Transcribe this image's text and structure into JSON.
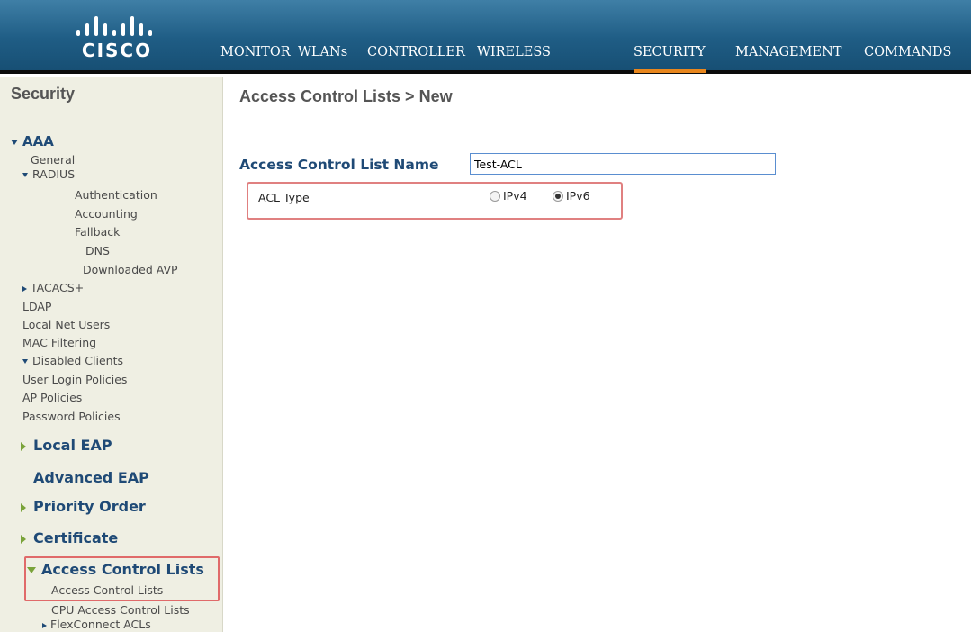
{
  "header": {
    "brand": "CISCO",
    "nav": [
      {
        "label": "MONITOR"
      },
      {
        "label": "WLANs"
      },
      {
        "label": "CONTROLLER"
      },
      {
        "label": "WIRELESS"
      },
      {
        "label": "SECURITY",
        "active": true
      },
      {
        "label": "MANAGEMENT"
      },
      {
        "label": "COMMANDS"
      }
    ],
    "active_underline_color": "#e8861d"
  },
  "sidebar": {
    "title": "Security",
    "aaa": {
      "label": "AAA",
      "general": "General",
      "radius": "RADIUS",
      "authentication": "Authentication",
      "accounting": "Accounting",
      "fallback": "Fallback",
      "dns": "DNS",
      "downloaded_avp": "Downloaded AVP",
      "tacacs": "TACACS+",
      "ldap": "LDAP",
      "local_net_users": "Local Net Users",
      "mac_filtering": "MAC Filtering",
      "disabled_clients": "Disabled Clients",
      "user_login_policies": "User Login Policies",
      "ap_policies": "AP Policies",
      "password_policies": "Password Policies"
    },
    "local_eap": "Local EAP",
    "advanced_eap": "Advanced EAP",
    "priority_order": "Priority Order",
    "certificate": "Certificate",
    "acl": {
      "label": "Access Control Lists",
      "access_control_lists": "Access Control Lists",
      "cpu_access_control_lists": "CPU Access Control Lists",
      "flexconnect_acls": "FlexConnect ACLs"
    }
  },
  "main": {
    "title": "Access Control Lists > New",
    "name_label": "Access Control List Name",
    "name_value": "Test-ACL",
    "acl_type_label": "ACL Type",
    "options": [
      {
        "label": "IPv4",
        "checked": false
      },
      {
        "label": "IPv6",
        "checked": true
      }
    ]
  }
}
